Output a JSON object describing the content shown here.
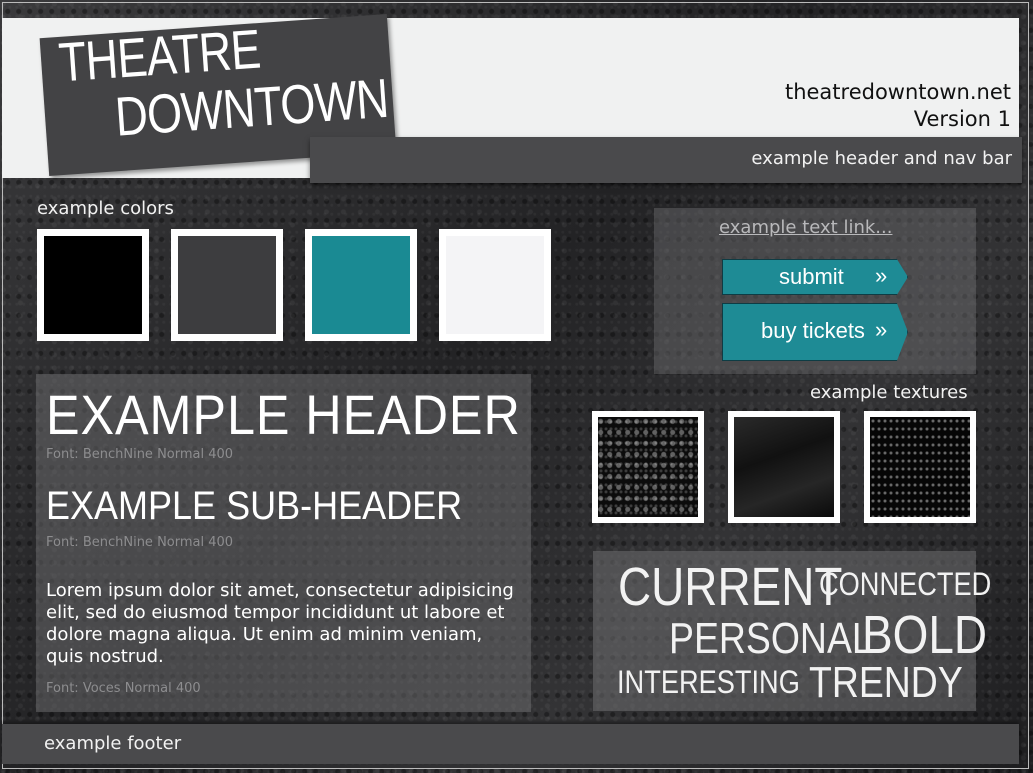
{
  "header": {
    "logo_line1": "THEATRE",
    "logo_line2": "DOWNTOWN",
    "site_url": "theatredowntown.net",
    "version": "Version 1"
  },
  "nav": {
    "label": "example header and nav bar"
  },
  "colors": {
    "label": "example colors",
    "swatches": [
      "#000000",
      "#3d3d3f",
      "#1a8a93",
      "#f4f4f6"
    ]
  },
  "links": {
    "text_link": "example text link...",
    "submit_label": "submit",
    "buy_label": "buy tickets",
    "arrow": "»",
    "accent": "#1e8b95"
  },
  "typography": {
    "header": "EXAMPLE HEADER",
    "header_font": "Font: BenchNine Normal 400",
    "subheader": "EXAMPLE SUB-HEADER",
    "subheader_font": "Font: BenchNine Normal 400",
    "body": "Lorem ipsum dolor sit amet, consectetur adipisicing elit, sed do eiusmod tempor incididunt ut labore et dolore magna aliqua. Ut enim ad minim veniam, quis nostrud.",
    "body_font": "Font: Voces Normal 400"
  },
  "textures": {
    "label": "example textures"
  },
  "words": [
    "CURRENT",
    "CONNECTED",
    "PERSONAL",
    "BOLD",
    "INTERESTING",
    "TRENDY"
  ],
  "footer": {
    "label": "example footer"
  }
}
